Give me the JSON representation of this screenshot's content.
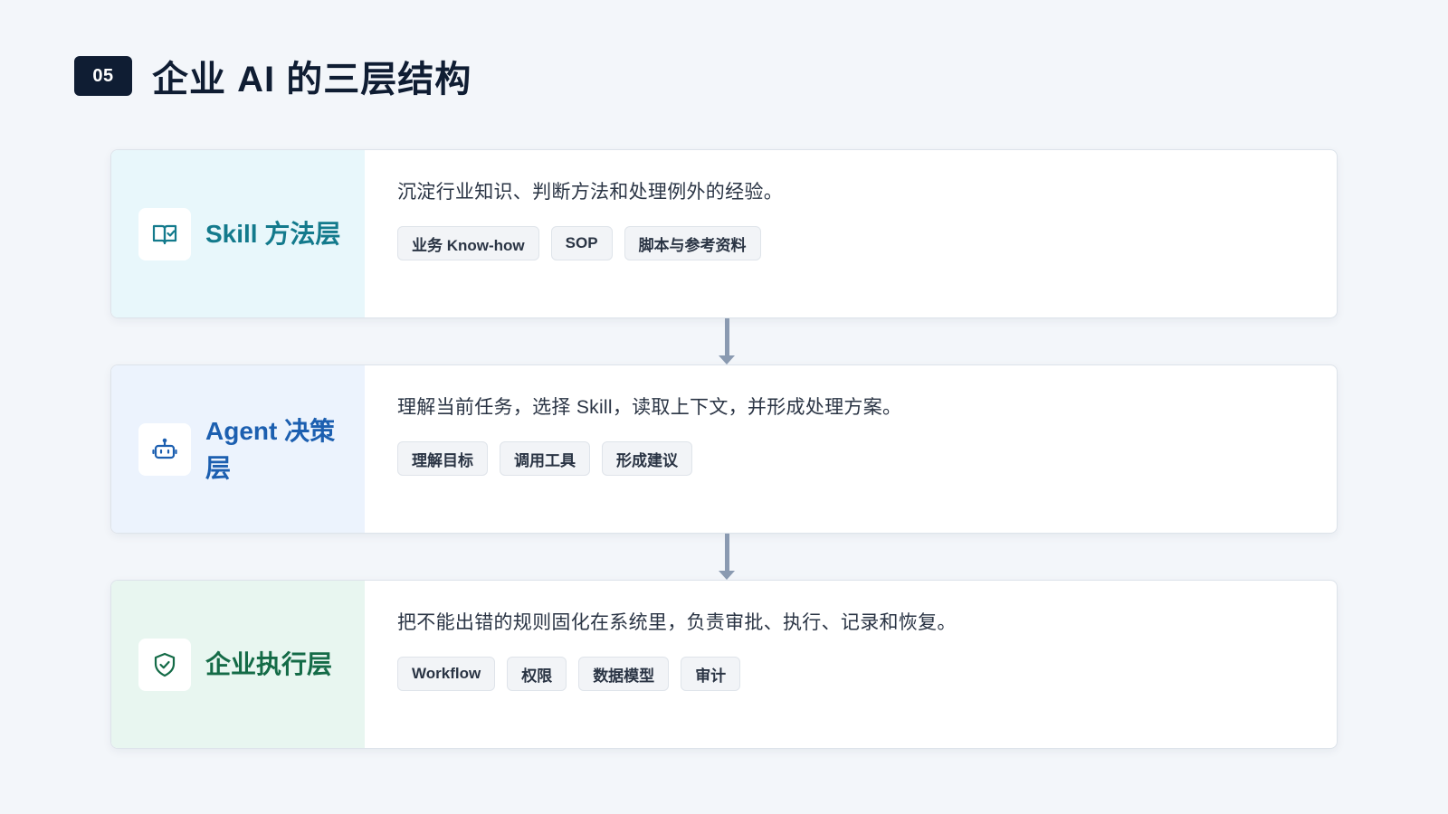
{
  "header": {
    "badge": "05",
    "title": "企业 AI 的三层结构"
  },
  "colors": {
    "skill_accent": "#137a8c",
    "agent_accent": "#1c5fb0",
    "exec_accent": "#146b47",
    "connector": "#8a9ab1"
  },
  "layers": [
    {
      "name": "Skill 方法层",
      "icon": "book-check-icon",
      "description": "沉淀行业知识、判断方法和处理例外的经验。",
      "tags": [
        "业务 Know-how",
        "SOP",
        "脚本与参考资料"
      ]
    },
    {
      "name": "Agent 决策层",
      "icon": "robot-icon",
      "description": "理解当前任务，选择 Skill，读取上下文，并形成处理方案。",
      "tags": [
        "理解目标",
        "调用工具",
        "形成建议"
      ]
    },
    {
      "name": "企业执行层",
      "icon": "shield-check-icon",
      "description": "把不能出错的规则固化在系统里，负责审批、执行、记录和恢复。",
      "tags": [
        "Workflow",
        "权限",
        "数据模型",
        "审计"
      ]
    }
  ]
}
